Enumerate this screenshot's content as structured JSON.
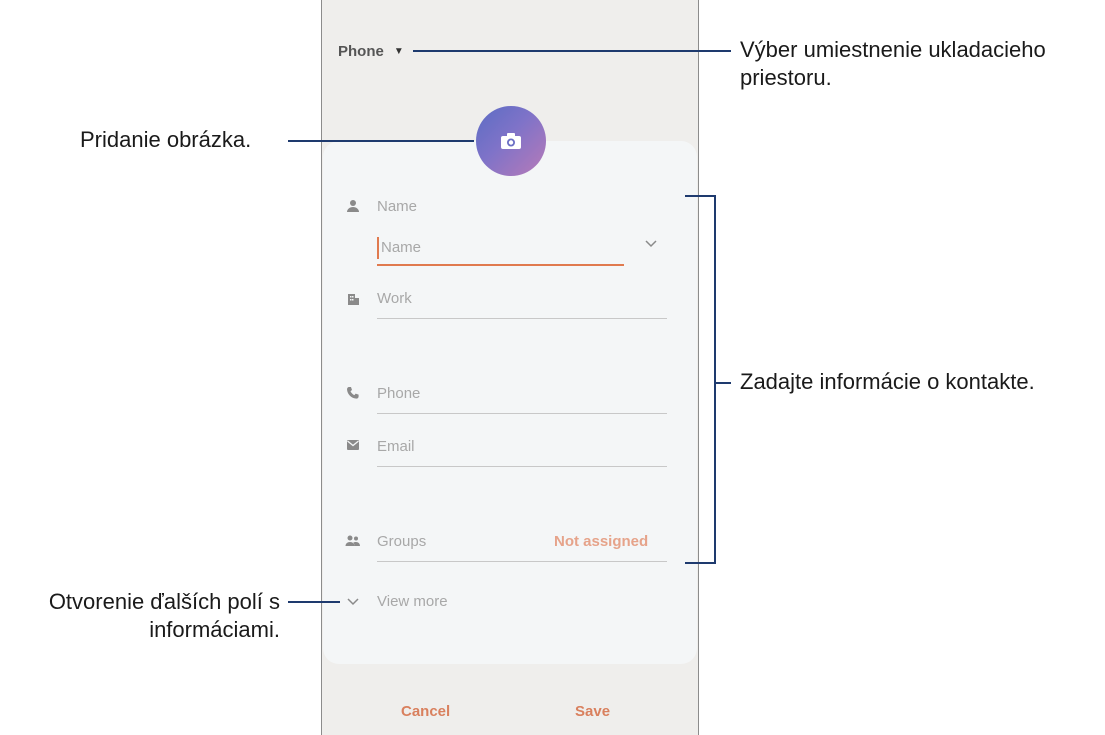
{
  "header": {
    "storage_label": "Phone"
  },
  "form": {
    "name_label": "Name",
    "name_input_placeholder": "Name",
    "work_label": "Work",
    "phone_label": "Phone",
    "email_label": "Email",
    "groups_label": "Groups",
    "groups_value": "Not assigned",
    "view_more_label": "View more"
  },
  "footer": {
    "cancel_label": "Cancel",
    "save_label": "Save"
  },
  "annotations": {
    "storage": "Výber umiestnenie ukladacieho priestoru.",
    "picture": "Pridanie obrázka.",
    "contact_info": "Zadajte informácie o kontakte.",
    "more_fields": "Otvorenie ďalších polí s informáciami."
  },
  "colors": {
    "accent": "#e07a4f",
    "callout_line": "#1e3a6e"
  }
}
